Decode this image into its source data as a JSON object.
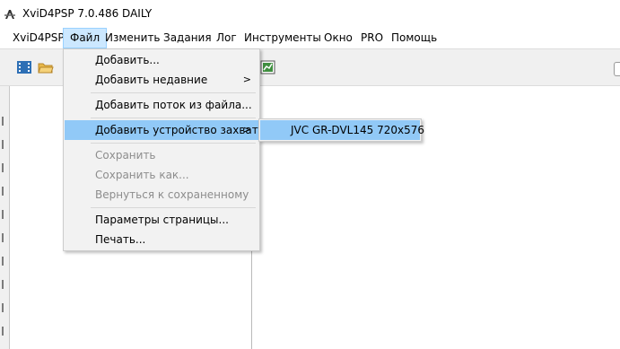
{
  "window": {
    "title": "XviD4PSP 7.0.486 DAILY",
    "icon": "app-logo-icon"
  },
  "menubar": {
    "items": [
      {
        "label": "XviD4PSP"
      },
      {
        "label": "Файл"
      },
      {
        "label": "Изменить"
      },
      {
        "label": "Задания"
      },
      {
        "label": "Лог"
      },
      {
        "label": "Инструменты"
      },
      {
        "label": "Окно"
      },
      {
        "label": "PRO"
      },
      {
        "label": "Помощь"
      }
    ],
    "active": "Файл"
  },
  "toolbar": {
    "icons": [
      "film-icon",
      "folder-open-icon",
      "chart-icon"
    ],
    "accent": "#f0f0f0"
  },
  "file_menu": {
    "items": [
      {
        "label": "Добавить...",
        "enabled": true,
        "submenu": false
      },
      {
        "label": "Добавить недавние",
        "enabled": true,
        "submenu": true
      },
      {
        "label": "Добавить поток из файла...",
        "enabled": true,
        "submenu": false
      },
      {
        "label": "Добавить устройство захвата",
        "enabled": true,
        "submenu": true,
        "highlighted": true
      },
      {
        "label": "Сохранить",
        "enabled": false,
        "submenu": false
      },
      {
        "label": "Сохранить как...",
        "enabled": false,
        "submenu": false
      },
      {
        "label": "Вернуться к сохраненному",
        "enabled": false,
        "submenu": false
      },
      {
        "label": "Параметры страницы...",
        "enabled": true,
        "submenu": false
      },
      {
        "label": "Печать...",
        "enabled": true,
        "submenu": false
      }
    ],
    "submenu_arrow": ">"
  },
  "capture_submenu": {
    "items": [
      {
        "label": "JVC GR-DVL145 720x576"
      }
    ]
  },
  "colors": {
    "highlight": "#91c9f7",
    "menu_active_bg": "#cce8ff",
    "disabled_text": "#8d8d8d"
  }
}
